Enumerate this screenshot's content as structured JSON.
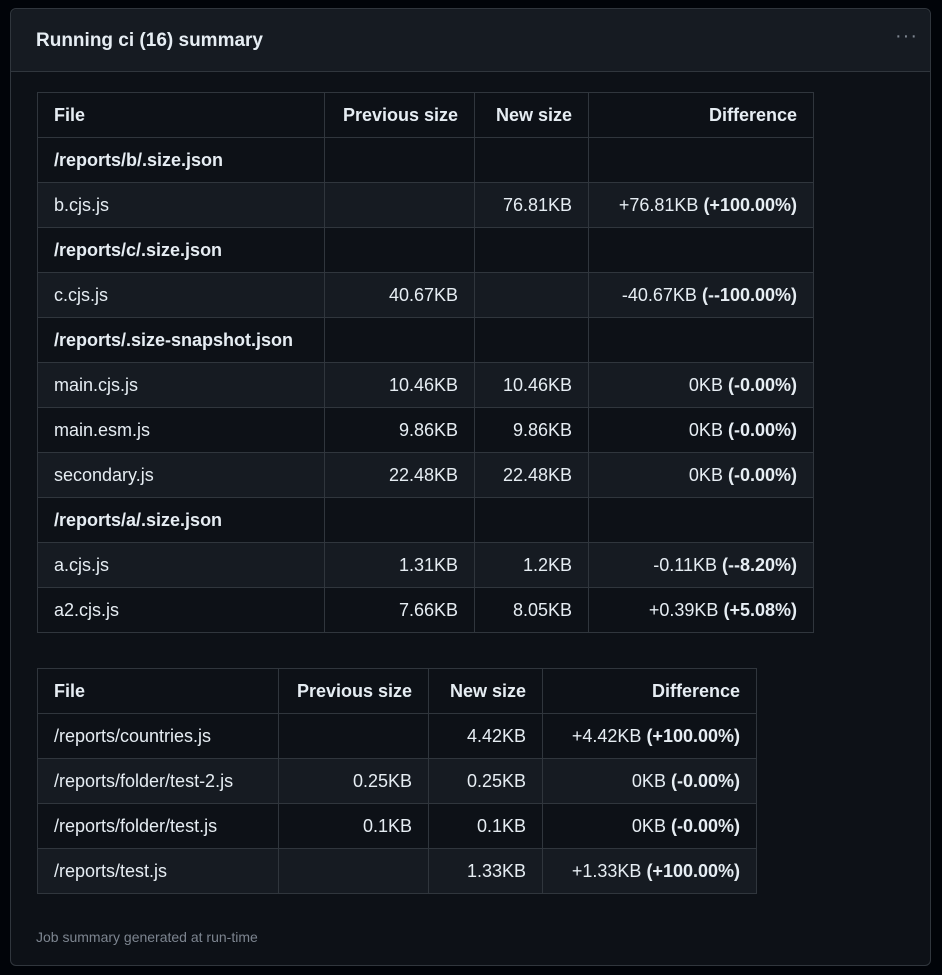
{
  "header": {
    "title": "Running ci (16) summary",
    "more_icon": "kebab-horizontal"
  },
  "table1": {
    "columns": [
      "File",
      "Previous size",
      "New size",
      "Difference"
    ],
    "rows": [
      {
        "group": "/reports/b/.size.json"
      },
      {
        "file": "b.cjs.js",
        "prev": "",
        "new": "76.81KB",
        "diff": "+76.81KB",
        "pct": "(+100.00%)"
      },
      {
        "group": "/reports/c/.size.json"
      },
      {
        "file": "c.cjs.js",
        "prev": "40.67KB",
        "new": "",
        "diff": "-40.67KB",
        "pct": "(--100.00%)"
      },
      {
        "group": "/reports/.size-snapshot.json"
      },
      {
        "file": "main.cjs.js",
        "prev": "10.46KB",
        "new": "10.46KB",
        "diff": "0KB",
        "pct": "(-0.00%)"
      },
      {
        "file": "main.esm.js",
        "prev": "9.86KB",
        "new": "9.86KB",
        "diff": "0KB",
        "pct": "(-0.00%)"
      },
      {
        "file": "secondary.js",
        "prev": "22.48KB",
        "new": "22.48KB",
        "diff": "0KB",
        "pct": "(-0.00%)"
      },
      {
        "group": "/reports/a/.size.json"
      },
      {
        "file": "a.cjs.js",
        "prev": "1.31KB",
        "new": "1.2KB",
        "diff": "-0.11KB",
        "pct": "(--8.20%)"
      },
      {
        "file": "a2.cjs.js",
        "prev": "7.66KB",
        "new": "8.05KB",
        "diff": "+0.39KB",
        "pct": "(+5.08%)"
      }
    ]
  },
  "table2": {
    "columns": [
      "File",
      "Previous size",
      "New size",
      "Difference"
    ],
    "rows": [
      {
        "file": "/reports/countries.js",
        "prev": "",
        "new": "4.42KB",
        "diff": "+4.42KB",
        "pct": "(+100.00%)"
      },
      {
        "file": "/reports/folder/test-2.js",
        "prev": "0.25KB",
        "new": "0.25KB",
        "diff": "0KB",
        "pct": "(-0.00%)"
      },
      {
        "file": "/reports/folder/test.js",
        "prev": "0.1KB",
        "new": "0.1KB",
        "diff": "0KB",
        "pct": "(-0.00%)"
      },
      {
        "file": "/reports/test.js",
        "prev": "",
        "new": "1.33KB",
        "diff": "+1.33KB",
        "pct": "(+100.00%)"
      }
    ]
  },
  "footer": "Job summary generated at run-time"
}
